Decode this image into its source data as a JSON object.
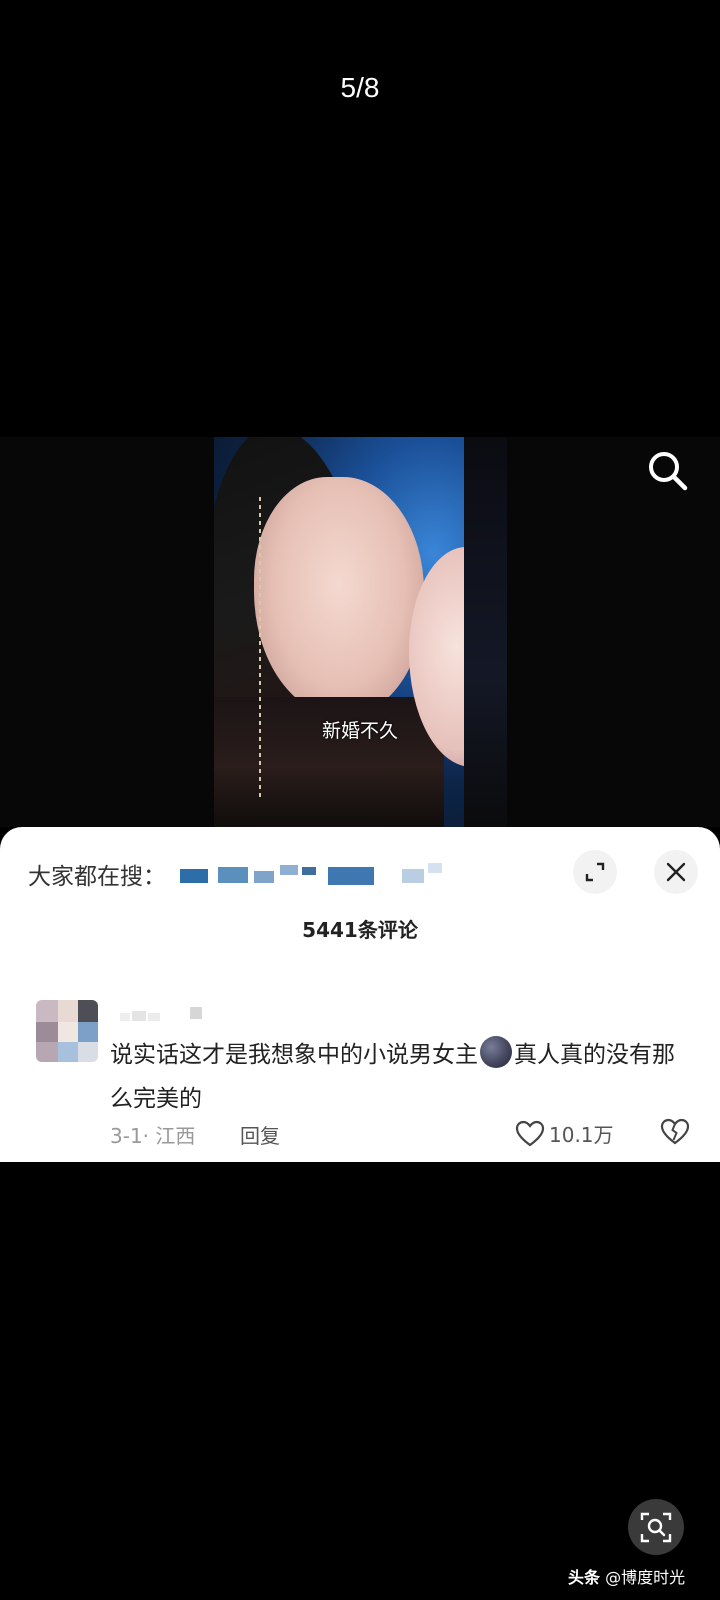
{
  "viewer": {
    "page_counter": "5/8"
  },
  "poster": {
    "caption": "新婚不久"
  },
  "comments_sheet": {
    "hot_search_label": "大家都在搜：",
    "comment_count_title": "5441条评论",
    "comment": {
      "text_before_emoji": "说实话这才是我想象中的小说男女主",
      "text_after_emoji": "真人真的没有那么完美的",
      "date_location": "3-1· 江西",
      "reply_label": "回复",
      "like_count": "10.1万"
    }
  },
  "watermark": {
    "platform": "头条",
    "handle": "@博度时光"
  },
  "icons": [
    "search-icon",
    "expand-icon",
    "close-icon",
    "emoji-icon",
    "heart-icon",
    "broken-heart-icon",
    "lens-search-icon"
  ]
}
